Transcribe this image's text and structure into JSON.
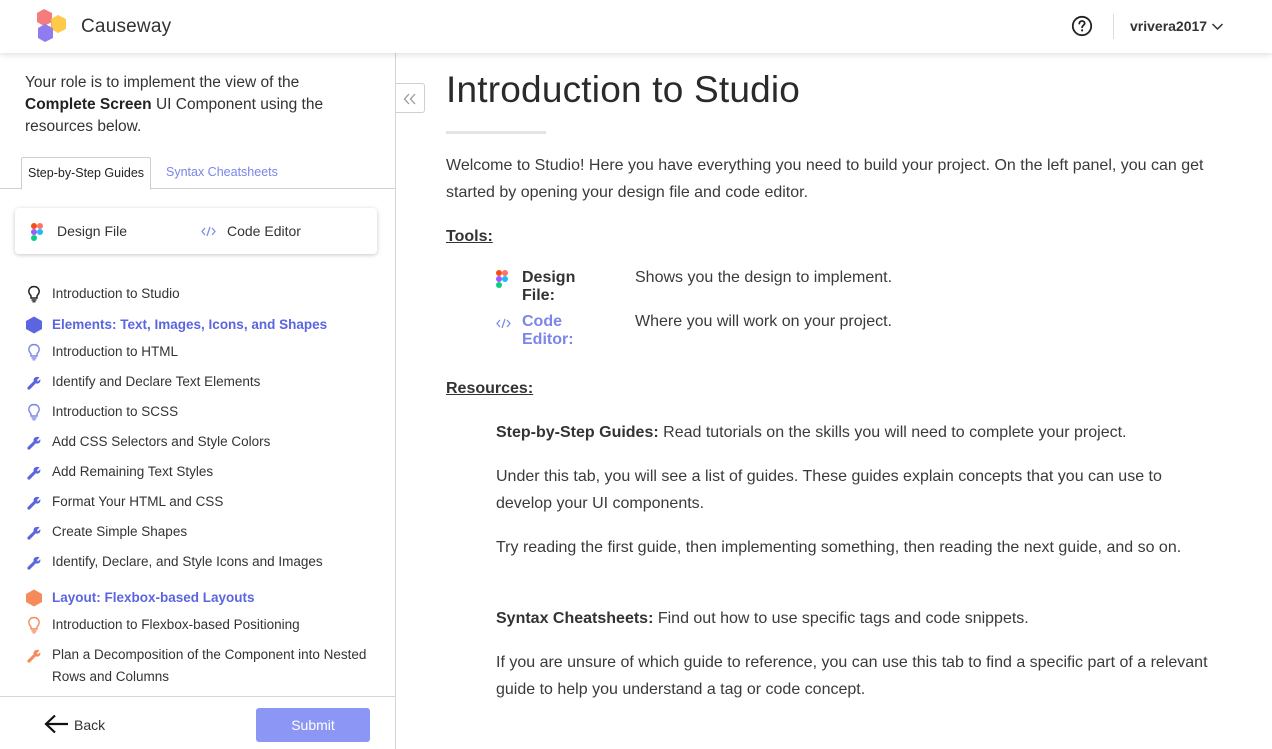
{
  "header": {
    "brand": "Causeway",
    "username": "vrivera2017"
  },
  "sidebar": {
    "role_prefix": "Your role is to implement the view of the ",
    "role_component": "Complete Screen",
    "role_suffix": " UI Component using the resources below.",
    "tabs": [
      {
        "label": "Step-by-Step Guides",
        "active": true
      },
      {
        "label": "Syntax Cheatsheets",
        "active": false
      }
    ],
    "tools": {
      "design": "Design File",
      "code": "Code Editor"
    },
    "guides": [
      {
        "label": "Introduction to Studio",
        "icon": "lightbulb-icon",
        "kind": "intro"
      },
      {
        "label": "Elements: Text, Images, Icons, and Shapes",
        "icon": "hexagon-icon",
        "kind": "section"
      },
      {
        "label": "Introduction to HTML",
        "icon": "lightbulb-icon",
        "kind": "item"
      },
      {
        "label": "Identify and Declare Text Elements",
        "icon": "wrench-icon",
        "kind": "item"
      },
      {
        "label": "Introduction to SCSS",
        "icon": "lightbulb-icon",
        "kind": "item"
      },
      {
        "label": "Add CSS Selectors and Style Colors",
        "icon": "wrench-icon",
        "kind": "item"
      },
      {
        "label": "Add Remaining Text Styles",
        "icon": "wrench-icon",
        "kind": "item"
      },
      {
        "label": "Format Your HTML and CSS",
        "icon": "wrench-icon",
        "kind": "item"
      },
      {
        "label": "Create Simple Shapes",
        "icon": "wrench-icon",
        "kind": "item"
      },
      {
        "label": "Identify, Declare, and Style Icons and Images",
        "icon": "wrench-icon",
        "kind": "item"
      },
      {
        "label": "Layout: Flexbox-based Layouts",
        "icon": "hexagon-icon",
        "kind": "section"
      },
      {
        "label": "Introduction to Flexbox-based Positioning",
        "icon": "lightbulb-icon",
        "kind": "item"
      },
      {
        "label": "Plan a Decomposition of the Component into Nested Rows and Columns",
        "icon": "wrench-icon",
        "kind": "item"
      }
    ],
    "footer": {
      "back": "Back",
      "submit": "Submit"
    }
  },
  "main": {
    "title": "Introduction to Studio",
    "welcome": "Welcome to Studio! Here you have everything you need to build your project. On the left panel, you can get started by opening your design file and code editor.",
    "tools_heading": "Tools:",
    "tools": [
      {
        "name": "Design File:",
        "desc": "Shows you the design to implement."
      },
      {
        "name": "Code Editor:",
        "desc": "Where you will work on your project."
      }
    ],
    "resources_heading": "Resources:",
    "resources": {
      "guides_label": "Step-by-Step Guides:",
      "guides_desc": " Read tutorials on the skills you will need to complete your project.",
      "guides_p2": "Under this tab, you will see a list of guides. These guides explain concepts that you can use to develop your UI components.",
      "guides_p3": "Try reading the first guide, then implementing something, then reading the next guide, and so on.",
      "cheat_label": "Syntax Cheatsheets:",
      "cheat_desc": " Find out how to use specific tags and code snippets.",
      "cheat_p2": "If you are unsure of which guide to reference, you can use this tab to find a specific part of a relevant guide to help you understand a tag or code concept."
    }
  },
  "colors": {
    "accent": "#5b65e0",
    "accent_light": "#7b86e8",
    "submit_bg": "#8c97f5",
    "orange": "#f58a5b"
  }
}
